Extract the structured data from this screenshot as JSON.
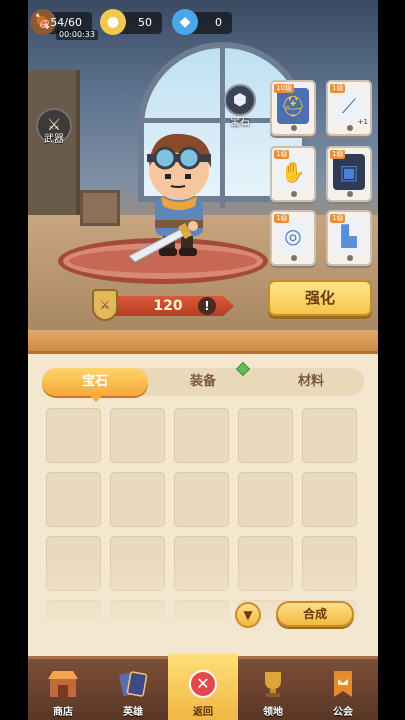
{
  "resources": {
    "stamina": "54/60",
    "stamina_timer": "00:00:33",
    "gold": "50",
    "diamond": "0"
  },
  "weapon_label": "武器",
  "gem_label": "宝石",
  "slots": [
    {
      "level": "10级",
      "icon": "helmet-icon",
      "extra": ""
    },
    {
      "level": "1级",
      "icon": "staff-icon",
      "extra": "+1"
    },
    {
      "level": "1级",
      "icon": "glove-icon",
      "extra": ""
    },
    {
      "level": "1级",
      "icon": "armor-icon",
      "extra": ""
    },
    {
      "level": "1级",
      "icon": "ring-icon",
      "extra": ""
    },
    {
      "level": "1级",
      "icon": "boot-icon",
      "extra": ""
    }
  ],
  "power": "120",
  "enhance_label": "强化",
  "tabs": [
    "宝石",
    "装备",
    "材料"
  ],
  "active_tab": 0,
  "combine_label": "合成",
  "nav": [
    {
      "label": "商店",
      "icon": "shop-icon"
    },
    {
      "label": "英雄",
      "icon": "hero-cards-icon"
    },
    {
      "label": "返回",
      "icon": "close-icon"
    },
    {
      "label": "领地",
      "icon": "trophy-icon"
    },
    {
      "label": "公会",
      "icon": "guild-banner-icon"
    }
  ],
  "active_nav": 2,
  "colors": {
    "accent": "#f5a93a",
    "power_bar": "#c94a2e",
    "nav_bg": "#6a4230",
    "close_red": "#e5484b"
  }
}
